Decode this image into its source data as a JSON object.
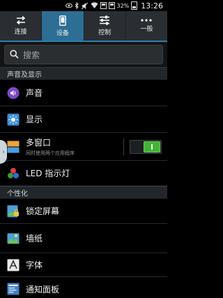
{
  "status_bar": {
    "battery_percent": "32%",
    "time": "13:26",
    "icons": [
      "eye-icon",
      "bluetooth-icon",
      "mute-icon",
      "wifi-icon",
      "notification-icon",
      "notification-icon",
      "battery-icon"
    ]
  },
  "tabs": [
    {
      "label": "连接",
      "icon": "swap-arrows-icon",
      "active": false
    },
    {
      "label": "设备",
      "icon": "phone-icon",
      "active": true
    },
    {
      "label": "控制",
      "icon": "sliders-icon",
      "active": false
    },
    {
      "label": "一般",
      "icon": "more-dots-icon",
      "active": false
    }
  ],
  "search": {
    "placeholder": "搜索"
  },
  "sections": {
    "sound_display": "声音及显示",
    "personalize": "个性化"
  },
  "items": {
    "sound": {
      "label": "声音",
      "icon": "sound-icon"
    },
    "display": {
      "label": "显示",
      "icon": "display-icon"
    },
    "multiwindow": {
      "label": "多窗口",
      "sub": "同时使用两个应用程序",
      "icon": "multiwindow-icon",
      "toggle_on": true
    },
    "led": {
      "label": "LED 指示灯",
      "icon": "led-icon"
    },
    "lockscreen": {
      "label": "锁定屏幕",
      "icon": "lockscreen-icon"
    },
    "wallpaper": {
      "label": "墙纸",
      "icon": "wallpaper-icon"
    },
    "font": {
      "label": "字体",
      "icon": "font-icon"
    },
    "notification_panel": {
      "label": "通知面板",
      "icon": "notification-panel-icon"
    }
  },
  "colors": {
    "accent": "#2d6e95",
    "toggle_on": "#44b236",
    "background": "#000000"
  }
}
